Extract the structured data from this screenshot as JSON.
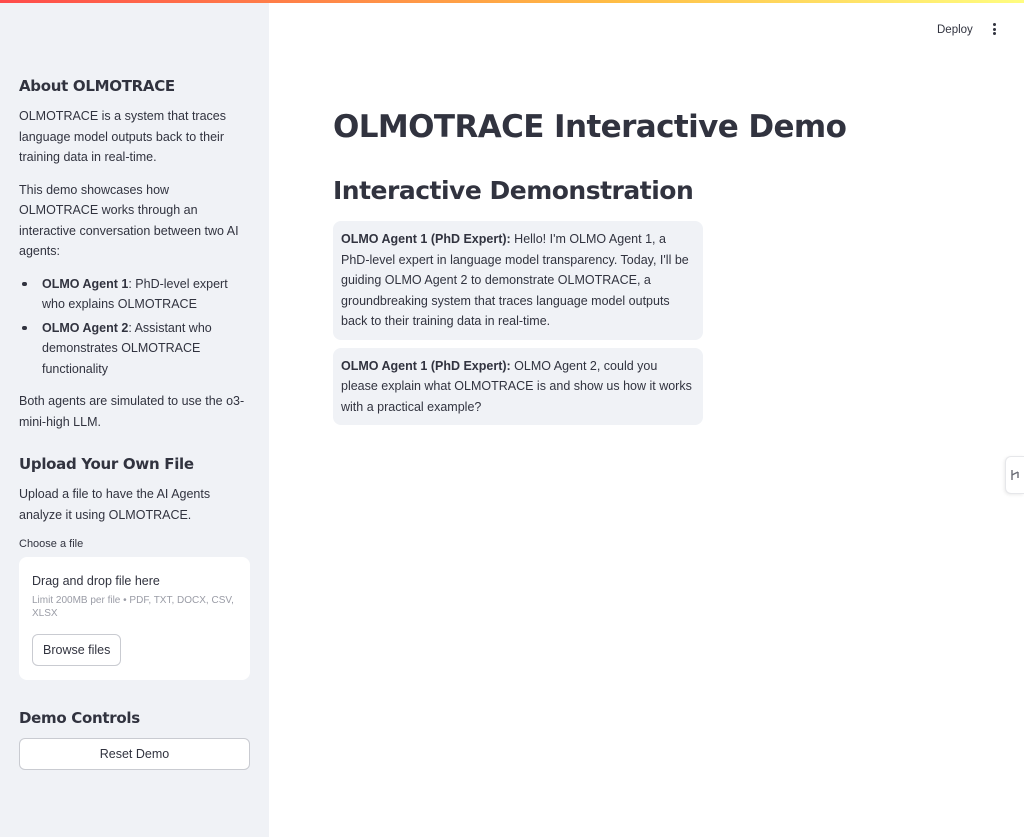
{
  "header": {
    "deploy_label": "Deploy",
    "menu_icon": "kebab-menu-icon"
  },
  "sidebar": {
    "about": {
      "heading": "About OLMOTRACE",
      "para1": "OLMOTRACE is a system that traces language model outputs back to their training data in real-time.",
      "para2": "This demo showcases how OLMOTRACE works through an interactive conversation between two AI agents:",
      "agents": [
        {
          "name": "OLMO Agent 1",
          "desc": ": PhD-level expert who explains OLMOTRACE"
        },
        {
          "name": "OLMO Agent 2",
          "desc": ": Assistant who demonstrates OLMOTRACE functionality"
        }
      ],
      "para3": "Both agents are simulated to use the o3-mini-high LLM."
    },
    "upload": {
      "heading": "Upload Your Own File",
      "description": "Upload a file to have the AI Agents analyze it using OLMOTRACE.",
      "file_label": "Choose a file",
      "drop_title": "Drag and drop file here",
      "limit_text": "Limit 200MB per file • PDF, TXT, DOCX, CSV, XLSX",
      "browse_label": "Browse files"
    },
    "controls": {
      "heading": "Demo Controls",
      "reset_label": "Reset Demo"
    }
  },
  "main": {
    "title": "OLMOTRACE Interactive Demo",
    "subtitle": "Interactive Demonstration",
    "messages": [
      {
        "speaker": "OLMO Agent 1 (PhD Expert):",
        "text": " Hello! I'm OLMO Agent 1, a PhD-level expert in language model transparency. Today, I'll be guiding OLMO Agent 2 to demonstrate OLMOTRACE, a groundbreaking system that traces language model outputs back to their training data in real-time."
      },
      {
        "speaker": "OLMO Agent 1 (PhD Expert):",
        "text": " OLMO Agent 2, could you please explain what OLMOTRACE is and show us how it works with a practical example?"
      }
    ]
  },
  "colors": {
    "sidebar_bg": "#f0f2f6",
    "text": "#31333f",
    "accent_gradient_start": "#ff4b4b",
    "accent_gradient_end": "#fffd80"
  }
}
